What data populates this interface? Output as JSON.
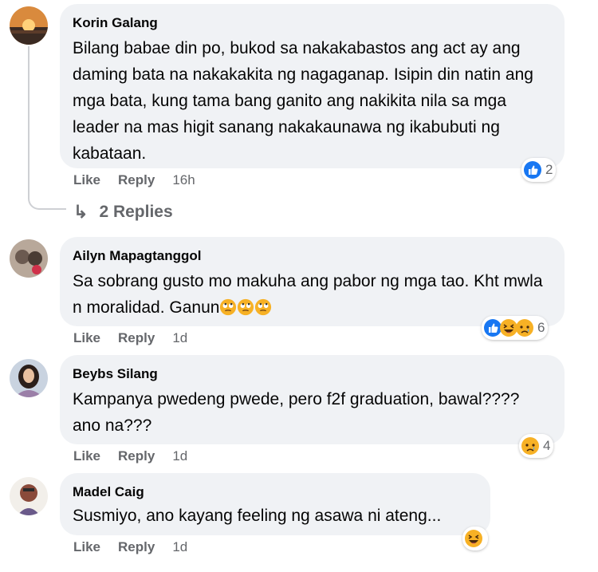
{
  "comments": [
    {
      "author": "Korin Galang",
      "text": "Bilang babae din po, bukod sa nakakabastos ang act ay ang daming bata na nakakakita ng nagaganap. Isipin din natin ang mga bata, kung tama bang ganito ang nakikita nila sa mga leader na mas higit sanang nakakaunawa ng ikabubuti ng kabataan.",
      "like_label": "Like",
      "reply_label": "Reply",
      "time": "16h",
      "reactions": [
        "like"
      ],
      "reaction_count": "2",
      "replies_label": "2 Replies"
    },
    {
      "author": "Ailyn Mapagtanggol",
      "text": "Sa sobrang gusto mo makuha ang pabor ng mga tao. Kht mwla n moralidad. Ganun",
      "inline_emojis": [
        "face-with-rolling-eyes",
        "face-with-rolling-eyes",
        "face-with-rolling-eyes"
      ],
      "like_label": "Like",
      "reply_label": "Reply",
      "time": "1d",
      "reactions": [
        "like",
        "haha",
        "sad"
      ],
      "reaction_count": "6"
    },
    {
      "author": "Beybs Silang",
      "text": "Kampanya pwedeng pwede, pero f2f graduation, bawal???? ano na???",
      "like_label": "Like",
      "reply_label": "Reply",
      "time": "1d",
      "reactions": [
        "sad"
      ],
      "reaction_count": "4"
    },
    {
      "author": "Madel Caig",
      "text": "Susmiyo, ano kayang feeling ng asawa ni ateng...",
      "like_label": "Like",
      "reply_label": "Reply",
      "time": "1d",
      "reactions": [
        "haha"
      ],
      "reaction_count": ""
    }
  ],
  "colors": {
    "bubble": "#f0f2f5",
    "meta_text": "#65676b",
    "like_blue": "#1877f2",
    "emoji_yellow": "#f7b125"
  }
}
